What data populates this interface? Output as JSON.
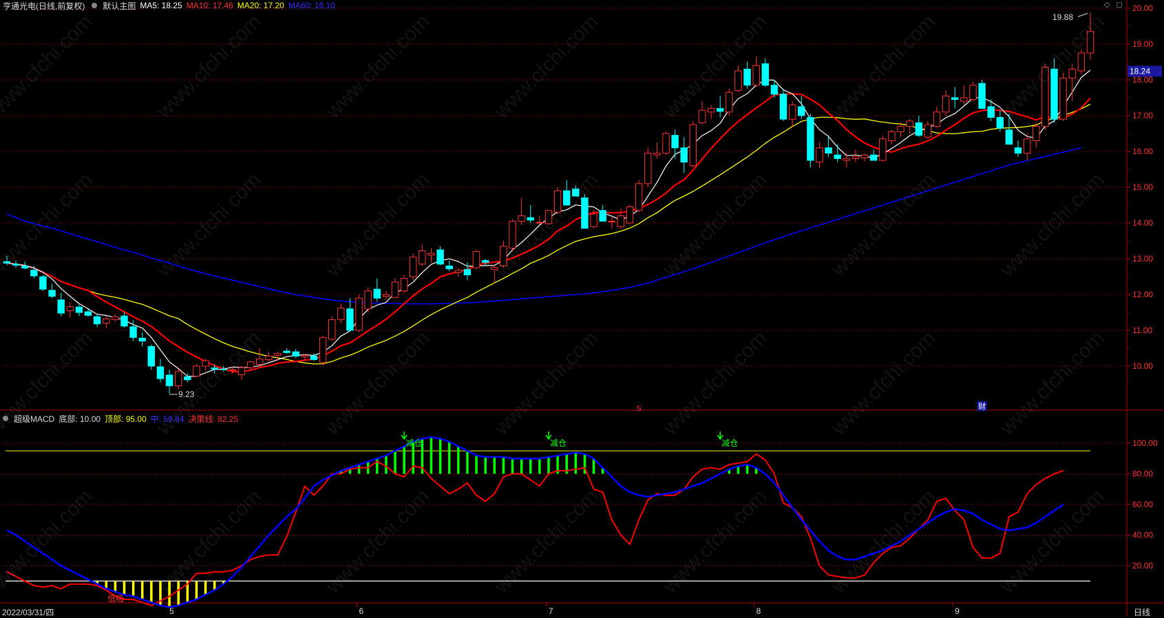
{
  "main_header": {
    "stock": "亨通光电(日线,前复权)",
    "template": "默认主图",
    "ma5": "MA5: 18.25",
    "ma10": "MA10: 17.46",
    "ma20": "MA20: 17.20",
    "ma60": "MA60: 16.10"
  },
  "sub_header": {
    "indicator": "超级MACD",
    "bottom": "底部: 10.00",
    "top": "顶部: 95.00",
    "middle": "中: 59.84",
    "decision": "决策线: 82.25"
  },
  "footer": {
    "date": "2022/03/31/四",
    "months": [
      "5",
      "6",
      "7",
      "8",
      "9"
    ],
    "period": "日线"
  },
  "watermark": "www.cfchi.com",
  "colors": {
    "up": "#ff3232",
    "down": "#00ffff",
    "ma5": "#ffffff",
    "ma10": "#ff0000",
    "ma20": "#ffff00",
    "ma60": "#0000ff",
    "grid": "#7a0000",
    "axis": "#b40000",
    "macd_main": "#0000ff",
    "decision": "#ff0000",
    "bar_high": "#00ff00",
    "bar_low": "#ffff00"
  },
  "chart_data": [
    {
      "type": "candlestick",
      "title": "亨通光电(日线,前复权)",
      "y_ticks": [
        "20.00",
        "19.00",
        "18.00",
        "17.00",
        "16.00",
        "15.00",
        "14.00",
        "13.00",
        "12.00",
        "11.00",
        "10.00"
      ],
      "ylim": [
        9.0,
        20.2
      ],
      "current_price_label": "18.24",
      "annotations": {
        "high": "19.88",
        "low": "9.23",
        "markers": [
          "S",
          "财"
        ]
      },
      "ohlc": [
        [
          12.92,
          13.08,
          12.82,
          12.88
        ],
        [
          12.85,
          12.95,
          12.75,
          12.82
        ],
        [
          12.8,
          12.92,
          12.7,
          12.74
        ],
        [
          12.68,
          12.8,
          12.45,
          12.52
        ],
        [
          12.5,
          12.55,
          12.1,
          12.15
        ],
        [
          12.12,
          12.3,
          11.9,
          11.95
        ],
        [
          11.85,
          12.05,
          11.4,
          11.48
        ],
        [
          11.55,
          11.78,
          11.35,
          11.66
        ],
        [
          11.65,
          11.72,
          11.4,
          11.5
        ],
        [
          11.52,
          11.6,
          11.38,
          11.42
        ],
        [
          11.38,
          11.45,
          11.1,
          11.18
        ],
        [
          11.2,
          11.4,
          11.05,
          11.32
        ],
        [
          11.3,
          11.45,
          11.25,
          11.38
        ],
        [
          11.4,
          11.5,
          11.08,
          11.12
        ],
        [
          11.1,
          11.28,
          10.7,
          10.8
        ],
        [
          10.78,
          10.95,
          10.55,
          10.7
        ],
        [
          10.55,
          10.6,
          9.9,
          10.0
        ],
        [
          9.98,
          10.2,
          9.55,
          9.65
        ],
        [
          9.75,
          9.9,
          9.23,
          9.45
        ],
        [
          9.45,
          9.92,
          9.35,
          9.85
        ],
        [
          9.7,
          9.8,
          9.55,
          9.62
        ],
        [
          9.72,
          10.05,
          9.7,
          10.0
        ],
        [
          10.0,
          10.2,
          9.88,
          10.15
        ],
        [
          9.95,
          10.05,
          9.8,
          9.92
        ],
        [
          9.92,
          10.0,
          9.85,
          9.9
        ],
        [
          9.88,
          9.98,
          9.78,
          9.9
        ],
        [
          9.76,
          10.0,
          9.62,
          9.96
        ],
        [
          9.96,
          10.15,
          9.9,
          10.12
        ],
        [
          10.05,
          10.5,
          9.95,
          10.2
        ],
        [
          10.18,
          10.4,
          10.1,
          10.28
        ],
        [
          10.3,
          10.4,
          10.15,
          10.35
        ],
        [
          10.42,
          10.5,
          10.35,
          10.38
        ],
        [
          10.4,
          10.48,
          10.22,
          10.28
        ],
        [
          10.26,
          10.34,
          10.14,
          10.3
        ],
        [
          10.28,
          10.36,
          10.15,
          10.18
        ],
        [
          10.1,
          10.85,
          10.02,
          10.8
        ],
        [
          10.75,
          11.4,
          10.7,
          11.3
        ],
        [
          11.3,
          11.75,
          11.2,
          11.62
        ],
        [
          11.6,
          11.9,
          11.15,
          11.0
        ],
        [
          11.0,
          12.0,
          10.95,
          11.9
        ],
        [
          11.6,
          12.2,
          11.5,
          12.1
        ],
        [
          12.15,
          12.45,
          11.8,
          11.9
        ],
        [
          11.95,
          12.1,
          11.85,
          12.0
        ],
        [
          11.92,
          12.45,
          11.9,
          12.35
        ],
        [
          12.1,
          12.55,
          12.05,
          12.45
        ],
        [
          12.5,
          13.15,
          12.4,
          13.05
        ],
        [
          12.85,
          13.4,
          12.8,
          13.22
        ],
        [
          13.1,
          13.3,
          12.9,
          13.15
        ],
        [
          13.25,
          13.35,
          12.82,
          12.85
        ],
        [
          12.8,
          12.95,
          12.65,
          12.72
        ],
        [
          12.62,
          12.75,
          12.5,
          12.68
        ],
        [
          12.7,
          12.9,
          12.4,
          12.55
        ],
        [
          12.75,
          13.25,
          12.7,
          13.2
        ],
        [
          12.95,
          13.0,
          12.8,
          12.9
        ],
        [
          12.7,
          12.8,
          12.35,
          12.76
        ],
        [
          12.8,
          13.5,
          12.75,
          13.35
        ],
        [
          13.3,
          14.1,
          13.2,
          14.05
        ],
        [
          14.05,
          14.7,
          13.95,
          14.2
        ],
        [
          14.15,
          14.5,
          14.0,
          14.08
        ],
        [
          14.0,
          14.2,
          13.95,
          14.02
        ],
        [
          13.98,
          14.3,
          13.95,
          14.35
        ],
        [
          14.3,
          15.0,
          14.25,
          14.9
        ],
        [
          14.9,
          15.2,
          14.8,
          14.5
        ],
        [
          14.95,
          15.05,
          14.85,
          14.75
        ],
        [
          14.7,
          14.8,
          13.85,
          13.85
        ],
        [
          13.9,
          14.35,
          13.85,
          14.25
        ],
        [
          14.35,
          14.5,
          14.15,
          14.05
        ],
        [
          14.05,
          14.15,
          13.85,
          14.05
        ],
        [
          13.9,
          14.4,
          13.85,
          14.2
        ],
        [
          14.0,
          14.5,
          13.95,
          14.45
        ],
        [
          14.35,
          15.2,
          14.3,
          15.1
        ],
        [
          15.1,
          16.1,
          15.0,
          15.95
        ],
        [
          15.9,
          16.25,
          15.8,
          15.95
        ],
        [
          15.95,
          16.55,
          15.9,
          16.5
        ],
        [
          16.45,
          16.6,
          15.8,
          16.1
        ],
        [
          16.1,
          16.4,
          15.4,
          15.7
        ],
        [
          15.6,
          16.85,
          15.55,
          16.75
        ],
        [
          16.8,
          17.4,
          16.75,
          17.15
        ],
        [
          17.1,
          17.3,
          16.9,
          17.2
        ],
        [
          17.2,
          17.55,
          16.95,
          17.12
        ],
        [
          17.1,
          17.75,
          17.0,
          17.65
        ],
        [
          17.7,
          18.4,
          17.65,
          18.25
        ],
        [
          18.3,
          18.5,
          17.75,
          17.85
        ],
        [
          17.85,
          18.65,
          17.8,
          18.4
        ],
        [
          18.45,
          18.6,
          17.8,
          17.85
        ],
        [
          17.85,
          18.0,
          17.5,
          17.6
        ],
        [
          17.6,
          17.75,
          16.85,
          16.9
        ],
        [
          16.9,
          17.4,
          16.7,
          17.3
        ],
        [
          17.25,
          17.55,
          16.9,
          17.0
        ],
        [
          16.95,
          17.05,
          15.55,
          15.75
        ],
        [
          15.7,
          16.25,
          15.55,
          16.1
        ],
        [
          16.1,
          16.45,
          15.85,
          15.95
        ],
        [
          15.9,
          16.2,
          15.7,
          15.8
        ],
        [
          15.75,
          15.95,
          15.55,
          15.8
        ],
        [
          15.8,
          16.05,
          15.7,
          15.85
        ],
        [
          15.82,
          15.95,
          15.72,
          15.9
        ],
        [
          15.9,
          16.05,
          15.75,
          15.75
        ],
        [
          15.75,
          16.45,
          15.7,
          16.35
        ],
        [
          16.3,
          16.6,
          16.2,
          16.55
        ],
        [
          16.55,
          16.8,
          16.4,
          16.7
        ],
        [
          16.7,
          16.9,
          16.5,
          16.85
        ],
        [
          16.8,
          17.0,
          16.4,
          16.45
        ],
        [
          16.4,
          16.85,
          16.35,
          16.75
        ],
        [
          16.7,
          17.25,
          16.65,
          17.1
        ],
        [
          17.1,
          17.7,
          17.0,
          17.55
        ],
        [
          17.5,
          17.8,
          17.2,
          17.45
        ],
        [
          17.4,
          17.85,
          17.3,
          17.5
        ],
        [
          17.45,
          17.95,
          17.4,
          17.85
        ],
        [
          17.9,
          18.0,
          17.2,
          17.2
        ],
        [
          17.25,
          17.45,
          16.85,
          16.95
        ],
        [
          16.95,
          17.15,
          16.55,
          16.65
        ],
        [
          16.6,
          17.05,
          16.35,
          16.2
        ],
        [
          16.1,
          16.3,
          15.85,
          15.95
        ],
        [
          15.95,
          16.5,
          15.75,
          16.35
        ],
        [
          16.3,
          16.8,
          16.1,
          16.7
        ],
        [
          16.7,
          18.45,
          16.6,
          18.35
        ],
        [
          18.3,
          18.6,
          16.8,
          16.9
        ],
        [
          16.9,
          18.2,
          16.85,
          18.05
        ],
        [
          18.05,
          18.45,
          17.4,
          18.3
        ],
        [
          18.25,
          18.85,
          18.15,
          18.75
        ],
        [
          18.75,
          19.88,
          18.55,
          19.35
        ]
      ],
      "ma60": [
        14.25,
        14.15,
        14.05,
        13.98,
        13.92,
        13.85,
        13.78,
        13.7,
        13.62,
        13.55,
        13.48,
        13.4,
        13.32,
        13.25,
        13.18,
        13.1,
        13.02,
        12.95,
        12.88,
        12.8,
        12.72,
        12.65,
        12.58,
        12.52,
        12.46,
        12.4,
        12.34,
        12.28,
        12.22,
        12.16,
        12.1,
        12.05,
        12.0,
        11.96,
        11.92,
        11.88,
        11.85,
        11.82,
        11.8,
        11.78,
        11.77,
        11.76,
        11.75,
        11.75,
        11.74,
        11.74,
        11.74,
        11.74,
        11.75,
        11.75,
        11.76,
        11.77,
        11.78,
        11.8,
        11.82,
        11.84,
        11.86,
        11.88,
        11.9,
        11.92,
        11.94,
        11.96,
        11.98,
        12.0,
        12.02,
        12.05,
        12.08,
        12.12,
        12.16,
        12.2,
        12.26,
        12.32,
        12.4,
        12.48,
        12.56,
        12.64,
        12.72,
        12.81,
        12.9,
        12.99,
        13.08,
        13.17,
        13.26,
        13.35,
        13.44,
        13.53,
        13.62,
        13.7,
        13.78,
        13.86,
        13.94,
        14.02,
        14.1,
        14.18,
        14.26,
        14.34,
        14.42,
        14.5,
        14.58,
        14.66,
        14.74,
        14.82,
        14.9,
        14.98,
        15.06,
        15.14,
        15.22,
        15.3,
        15.38,
        15.46,
        15.54,
        15.62,
        15.68,
        15.74,
        15.8,
        15.86,
        15.92,
        15.98,
        16.04,
        16.1
      ]
    },
    {
      "type": "line",
      "title": "超级MACD",
      "y_ticks": [
        "100.00",
        "80.00",
        "60.00",
        "40.00",
        "20.00"
      ],
      "ylim": [
        0,
        115
      ],
      "reference_lines": {
        "top": 95.0,
        "bottom": 10.0
      },
      "signals": [
        {
          "label": "减仓",
          "index": 44
        },
        {
          "label": "减仓",
          "index": 60
        },
        {
          "label": "减仓",
          "index": 79
        }
      ],
      "bottom_label": {
        "label": "低吸",
        "index": 11
      },
      "series": [
        {
          "name": "中",
          "values": [
            43,
            40,
            36,
            32,
            28,
            24,
            20,
            17,
            14,
            11,
            8,
            5,
            3,
            1,
            0,
            -2,
            -4,
            -6,
            -7,
            -6,
            -4,
            -2,
            1,
            4,
            8,
            13,
            19,
            26,
            33,
            40,
            46,
            52,
            57,
            64,
            72,
            76,
            79,
            82,
            84,
            86,
            88,
            90,
            92,
            95,
            98,
            101,
            103,
            104,
            103,
            101,
            98,
            95,
            92,
            91,
            91,
            91,
            90,
            90,
            90,
            90,
            91,
            92,
            93,
            94,
            93,
            90,
            84,
            78,
            72,
            68,
            66,
            65,
            66,
            67,
            68,
            70,
            72,
            74,
            77,
            80,
            83,
            85,
            86,
            84,
            80,
            74,
            66,
            58,
            50,
            43,
            36,
            30,
            26,
            24,
            24,
            26,
            28,
            30,
            33,
            36,
            40,
            44,
            48,
            52,
            55,
            57,
            56,
            54,
            50,
            47,
            44,
            43,
            44,
            45,
            48,
            52,
            56,
            60
          ]
        },
        {
          "name": "决策线",
          "values": [
            16,
            13,
            10,
            7,
            6,
            7,
            5,
            8,
            8,
            8,
            7,
            4,
            0,
            -2,
            -2,
            -4,
            -6,
            -3,
            0,
            4,
            8,
            15,
            15,
            16,
            16,
            17,
            20,
            24,
            26,
            27,
            27,
            39,
            55,
            72,
            66,
            72,
            80,
            80,
            83,
            84,
            84,
            88,
            85,
            80,
            78,
            85,
            84,
            77,
            72,
            67,
            70,
            74,
            66,
            62,
            67,
            78,
            80,
            80,
            76,
            72,
            80,
            82,
            82,
            83,
            84,
            70,
            68,
            50,
            40,
            34,
            50,
            63,
            67,
            66,
            66,
            70,
            78,
            83,
            84,
            83,
            86,
            87,
            88,
            93,
            89,
            80,
            61,
            58,
            52,
            38,
            20,
            14,
            13,
            12,
            12,
            14,
            22,
            28,
            32,
            33,
            38,
            44,
            50,
            62,
            64,
            56,
            50,
            32,
            25,
            25,
            28,
            52,
            55,
            67,
            73,
            77,
            80,
            82
          ]
        }
      ]
    }
  ]
}
